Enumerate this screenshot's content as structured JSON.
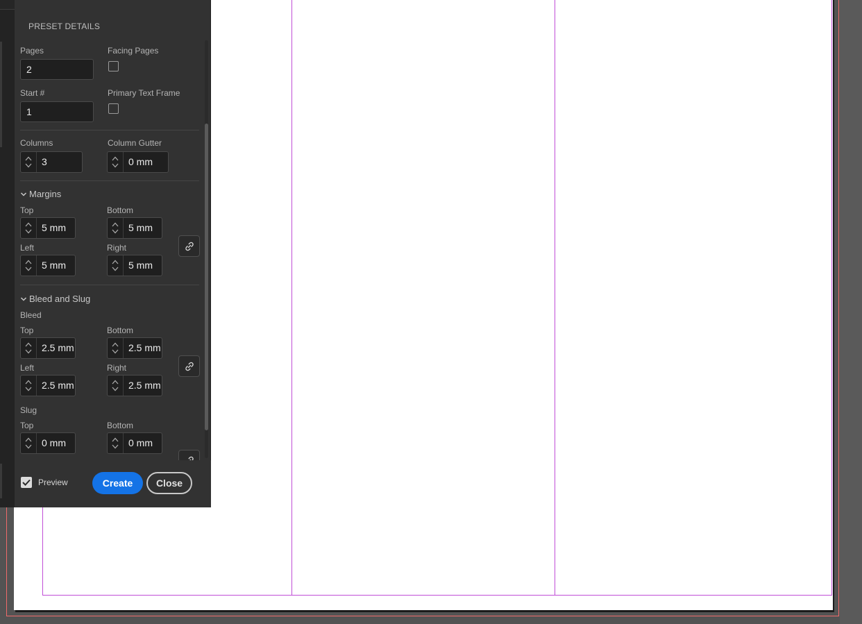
{
  "panel": {
    "header": "PRESET DETAILS",
    "pages": {
      "label": "Pages",
      "value": "2"
    },
    "facing_pages": {
      "label": "Facing Pages",
      "checked": false
    },
    "start_number": {
      "label": "Start #",
      "value": "1"
    },
    "primary_text_frame": {
      "label": "Primary Text Frame",
      "checked": false
    },
    "columns": {
      "label": "Columns",
      "value": "3"
    },
    "column_gutter": {
      "label": "Column Gutter",
      "value": "0 mm"
    },
    "margins": {
      "title": "Margins",
      "top": {
        "label": "Top",
        "value": "5 mm"
      },
      "bottom": {
        "label": "Bottom",
        "value": "5 mm"
      },
      "left": {
        "label": "Left",
        "value": "5 mm"
      },
      "right": {
        "label": "Right",
        "value": "5 mm"
      }
    },
    "bleed_slug": {
      "title": "Bleed and Slug",
      "bleed": {
        "title": "Bleed",
        "top": {
          "label": "Top",
          "value": "2.5 mm"
        },
        "bottom": {
          "label": "Bottom",
          "value": "2.5 mm"
        },
        "left": {
          "label": "Left",
          "value": "2.5 mm"
        },
        "right": {
          "label": "Right",
          "value": "2.5 mm"
        }
      },
      "slug": {
        "title": "Slug",
        "top": {
          "label": "Top",
          "value": "0 mm"
        },
        "bottom": {
          "label": "Bottom",
          "value": "0 mm"
        }
      }
    },
    "footer": {
      "preview_label": "Preview",
      "preview_checked": true,
      "create_label": "Create",
      "close_label": "Close"
    }
  },
  "colors": {
    "accent": "#1473e6",
    "margin_guide": "#c04dd6",
    "bleed_guide": "#f06b6b",
    "panel_bg": "#323232"
  }
}
